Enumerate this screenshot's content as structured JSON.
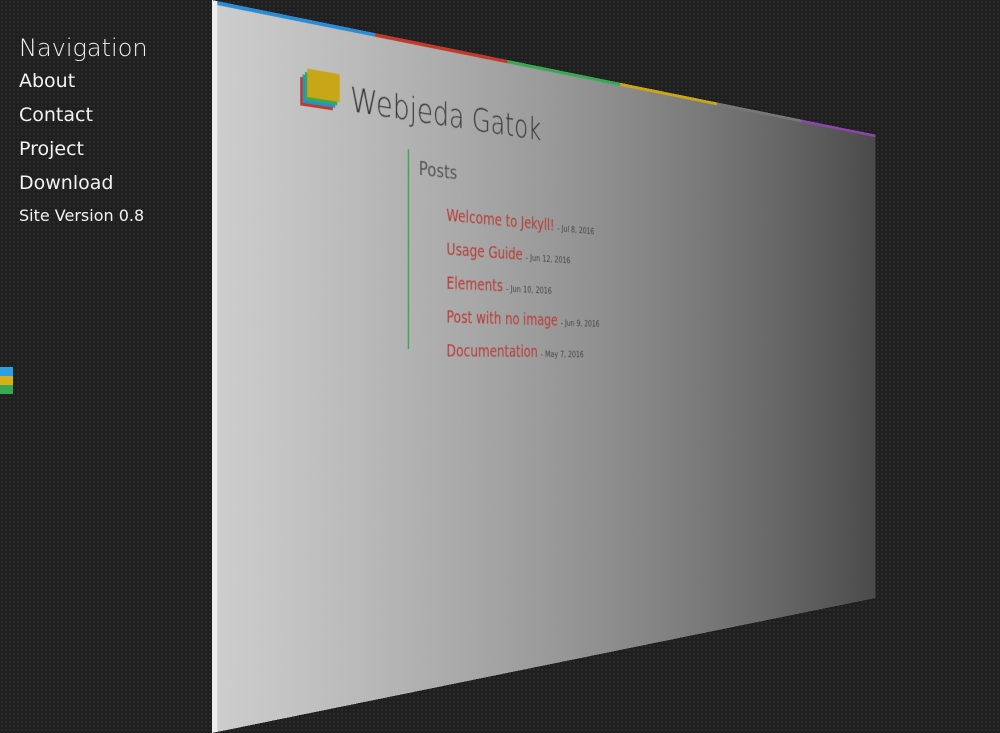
{
  "nav": {
    "heading": "Navigation",
    "items": [
      "About",
      "Contact",
      "Project",
      "Download"
    ],
    "version": "Site Version 0.8"
  },
  "colors": {
    "blue": "#2b8cd6",
    "red": "#c0392b",
    "green": "#3aa757",
    "yellow": "#c9a617",
    "gray": "#777777",
    "purple": "#8e44ad"
  },
  "site": {
    "title": "Webjeda Gatok"
  },
  "posts": {
    "heading": "Posts",
    "items": [
      {
        "title": "Welcome to Jekyll!",
        "date": "- Jul 8, 2016"
      },
      {
        "title": "Usage Guide",
        "date": "- Jun 12, 2016"
      },
      {
        "title": "Elements",
        "date": "- Jun 10, 2016"
      },
      {
        "title": "Post with no image",
        "date": "- Jun 9, 2016"
      },
      {
        "title": "Documentation",
        "date": "- May 7, 2016"
      }
    ]
  }
}
